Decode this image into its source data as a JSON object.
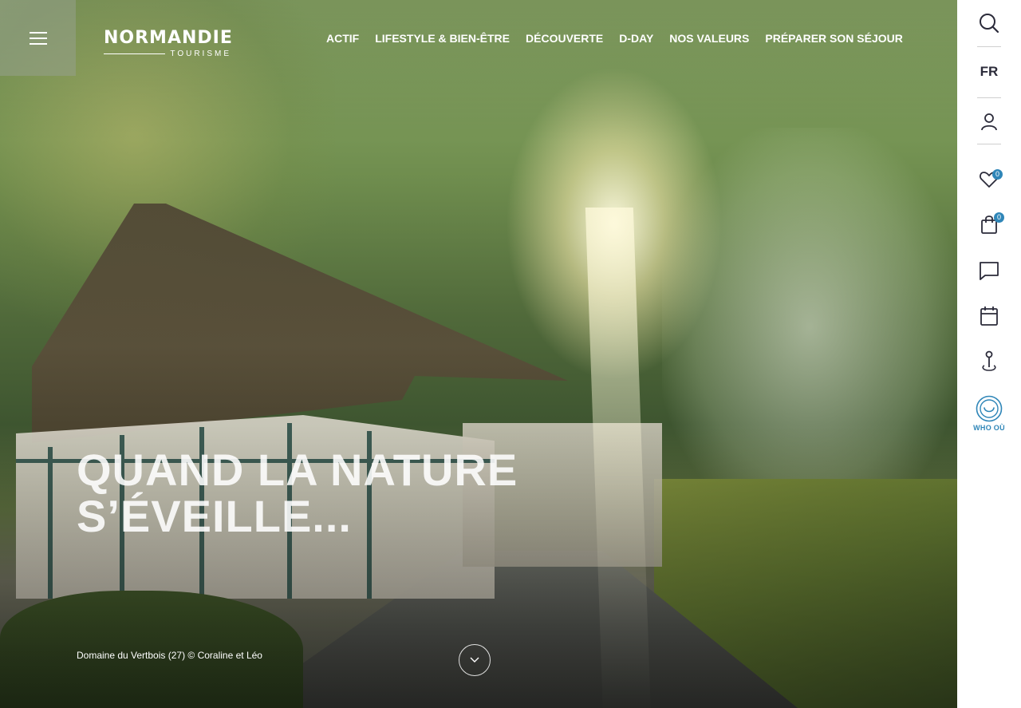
{
  "menu": {
    "burger_icon": "hamburger-menu-icon"
  },
  "logo": {
    "main": "NORMANDIE",
    "sub": "TOURISME"
  },
  "nav": {
    "items": [
      {
        "label": "ACTIF"
      },
      {
        "label": "LIFESTYLE & BIEN-ÊTRE"
      },
      {
        "label": "DÉCOUVERTE"
      },
      {
        "label": "D-DAY"
      },
      {
        "label": "NOS VALEURS"
      },
      {
        "label": "PRÉPARER SON SÉJOUR"
      }
    ]
  },
  "hero": {
    "title_line1": "QUAND LA NATURE",
    "title_line2": "S’ÉVEILLE...",
    "caption": "Domaine du Vertbois (27) © Coraline et Léo",
    "scroll_icon": "chevron-down-icon"
  },
  "sidebar": {
    "language": "FR",
    "favorites_count": "0",
    "cart_count": "0",
    "whoou_label": "WHO OÙ",
    "icons": [
      "search-icon",
      "user-icon",
      "heart-icon",
      "shopping-bag-icon",
      "chat-icon",
      "calendar-icon",
      "map-pin-icon",
      "whoou-icon"
    ]
  },
  "colors": {
    "accent": "#2f86b8",
    "sidebar_text": "#2b2b3a",
    "hero_text": "#ffffff"
  }
}
